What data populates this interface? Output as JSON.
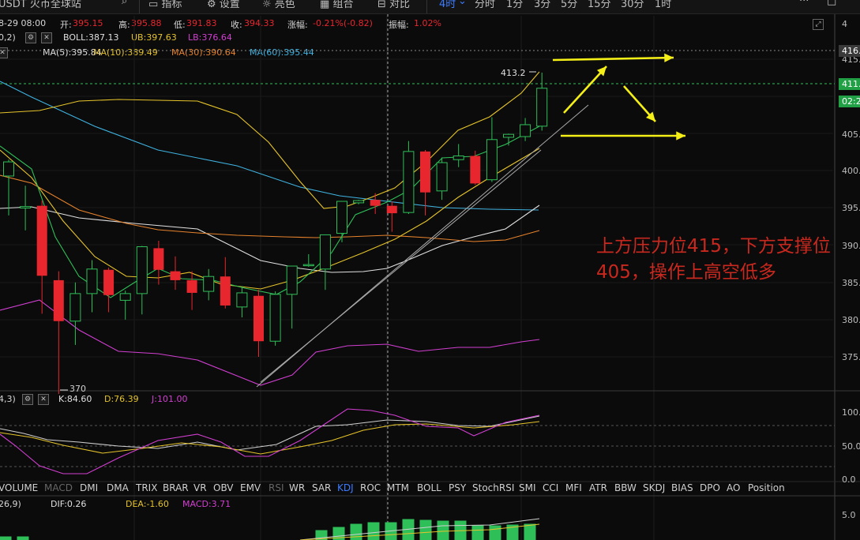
{
  "toolbar": {
    "pair": "USDT 火币全球站",
    "indicators": "指标",
    "settings": "设置",
    "draw": "亮色",
    "combo": "组合",
    "compare": "对比",
    "timeframes": [
      "4时",
      "分时",
      "1分",
      "3分",
      "5分",
      "15分",
      "30分",
      "1时"
    ],
    "active_timeframe": "4时"
  },
  "infobar": {
    "date": "8-29 08:00",
    "open_label": "开:",
    "open": "395.15",
    "high_label": "高:",
    "high": "395.88",
    "low_label": "低:",
    "low": "391.83",
    "close_label": "收:",
    "close": "394.33",
    "change_label": "涨幅:",
    "change": "-0.21%(-0.82)",
    "amp_label": "振幅:",
    "amp": "1.02%"
  },
  "boll": {
    "params": "0,2)",
    "boll": "BOLL:387.13",
    "ub": "UB:397.63",
    "lb": "LB:376.64"
  },
  "ma": {
    "ma5": "MA(5):395.84",
    "ma10": "MA(10):389.49",
    "ma30": "MA(30):390.64",
    "ma60": "MA(60):395.44"
  },
  "price_axis": [
    "415.",
    "411.",
    "405.",
    "400.",
    "395.",
    "390.",
    "385.",
    "380.",
    "375."
  ],
  "price_axis_top": "4",
  "price_tags": {
    "upper": "416.",
    "current": "411.",
    "countdown": "02:28"
  },
  "high_marker": "413.2",
  "low_marker": "370",
  "kdj": {
    "params": "4,3)",
    "k": "K:84.60",
    "d": "D:76.39",
    "j": "J:101.00",
    "axis": [
      "100.",
      "50.0",
      "0.0"
    ]
  },
  "indicator_tabs": [
    "VOLUME",
    "MACD",
    "DMI",
    "DMA",
    "TRIX",
    "BRAR",
    "VR",
    "OBV",
    "EMV",
    "RSI",
    "WR",
    "SAR",
    "KDJ",
    "ROC",
    "MTM",
    "BOLL",
    "PSY",
    "StochRSI",
    "SMI",
    "CCI",
    "MFI",
    "ATR",
    "BBW",
    "SKDJ",
    "BIAS",
    "DPO",
    "AO",
    "Position"
  ],
  "active_tab": "KDJ",
  "macd": {
    "params": "26,9)",
    "dif": "DIF:0.26",
    "dea": "DEA:-1.60",
    "macd": "MACD:3.71",
    "axis": "5.0"
  },
  "annotation": "上方压力位415，下方支撑位405，操作上高空低多",
  "colors": {
    "up": "#2fbf58",
    "down": "#e8262e",
    "ma5": "#e0e0e0",
    "ma10": "#e5c32a",
    "ma30": "#e6822c",
    "ma60": "#3fb2e0",
    "ub": "#e5c32a",
    "lb": "#d13fd1",
    "mid": "#e0e0e0",
    "arrow": "#f5ef18",
    "annotation": "#c8281e"
  },
  "chart_data": {
    "type": "candlestick",
    "candles_ohlc": [
      [
        399.3,
        401.5,
        394.0,
        401.2
      ],
      [
        395.0,
        398.0,
        392.0,
        395.2
      ],
      [
        395.3,
        396.0,
        380.8,
        385.9
      ],
      [
        385.3,
        386.5,
        370.0,
        379.8
      ],
      [
        379.8,
        385.0,
        376.6,
        383.5
      ],
      [
        383.5,
        388.0,
        381.0,
        386.8
      ],
      [
        386.7,
        387.0,
        381.0,
        383.3
      ],
      [
        382.6,
        383.9,
        380.0,
        383.5
      ],
      [
        383.5,
        389.9,
        380.7,
        389.8
      ],
      [
        389.6,
        390.6,
        384.7,
        386.7
      ],
      [
        386.5,
        388.5,
        384.0,
        385.3
      ],
      [
        385.3,
        386.5,
        381.3,
        383.6
      ],
      [
        383.8,
        386.8,
        382.6,
        385.8
      ],
      [
        385.8,
        388.4,
        381.5,
        381.9
      ],
      [
        381.7,
        384.5,
        380.3,
        383.6
      ],
      [
        383.2,
        384.0,
        375.0,
        377.1
      ],
      [
        377.1,
        383.8,
        376.5,
        383.4
      ],
      [
        383.4,
        386.5,
        378.8,
        387.2
      ],
      [
        387.4,
        388.8,
        387.1,
        387.4
      ],
      [
        386.8,
        387.7,
        384.0,
        391.4
      ],
      [
        391.6,
        395.0,
        390.4,
        395.9
      ],
      [
        395.7,
        396.1,
        395.5,
        396.0
      ],
      [
        396.1,
        397.0,
        394.2,
        395.3
      ],
      [
        395.3,
        395.9,
        391.8,
        394.3
      ],
      [
        394.4,
        404.0,
        394.2,
        402.6
      ],
      [
        402.6,
        402.8,
        394.0,
        397.1
      ],
      [
        397.3,
        401.8,
        396.1,
        401.1
      ],
      [
        401.5,
        403.6,
        400.5,
        402.0
      ],
      [
        402.0,
        402.7,
        398.1,
        398.3
      ],
      [
        398.8,
        407.2,
        398.5,
        404.2
      ],
      [
        404.5,
        405.0,
        403.4,
        404.9
      ],
      [
        404.6,
        407.1,
        404.0,
        406.2
      ],
      [
        406.0,
        413.2,
        405.4,
        411.1
      ]
    ]
  }
}
